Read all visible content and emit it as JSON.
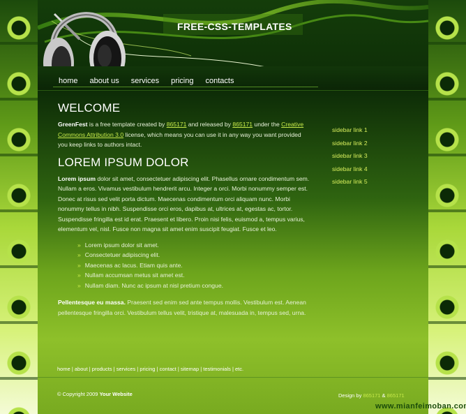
{
  "header": {
    "logo": "FREE-CSS-TEMPLATES"
  },
  "nav": {
    "items": [
      {
        "label": "home"
      },
      {
        "label": "about us"
      },
      {
        "label": "services"
      },
      {
        "label": "pricing"
      },
      {
        "label": "contacts"
      }
    ]
  },
  "welcome": {
    "title": "WELCOME",
    "brand": "GreenFest",
    "text1": " is a free template created by ",
    "link1": "865171",
    "text2": " and released by ",
    "link2": "865171",
    "text3": " under the ",
    "license": "Creative Commons Attribution 3.0",
    "text4": " license, which means you can use it in any way you want provided you keep links to authors intact."
  },
  "lorem": {
    "title": "LOREM IPSUM DOLOR",
    "p1_strong": "Lorem ipsum",
    "p1_text": " dolor sit amet, consectetuer adipiscing elit. Phasellus ornare condimentum sem. Nullam a eros. Vivamus vestibulum hendrerit arcu. Integer a orci. Morbi nonummy semper est. Donec at risus sed velit porta dictum. Maecenas condimentum orci aliquam nunc. Morbi nonummy tellus in nibh. Suspendisse orci eros, dapibus at, ultrices at, egestas ac, tortor. Suspendisse fringilla est id erat. Praesent et libero. Proin nisi felis, euismod a, tempus varius, elementum vel, nisl. Fusce non magna sit amet enim suscipit feugiat. Fusce et leo.",
    "list": [
      "Lorem ipsum dolor sit amet.",
      "Consectetuer adipiscing elit.",
      "Maecenas ac lacus. Etiam quis ante.",
      "Nullam accumsan metus sit amet est.",
      "Nullam diam. Nunc ac ipsum at nisl pretium congue."
    ],
    "bullet": "»",
    "p2_strong": "Pellentesque eu massa.",
    "p2_text": " Praesent sed enim sed ante tempus mollis. Vestibulum est. Aenean pellentesque fringilla orci. Vestibulum tellus velit, tristique at, malesuada in, tempus sed, urna."
  },
  "sidebar": {
    "links": [
      "sidebar link 1",
      "sidebar link 2",
      "sidebar link 3",
      "sidebar link 4",
      "sidebar link 5"
    ]
  },
  "footer": {
    "links": [
      "home",
      "about",
      "products",
      "services",
      "pricing",
      "contact",
      "sitemap",
      "testimonials",
      "etc."
    ],
    "separator": " | ",
    "copyright_prefix": "© Copyright 2009 ",
    "copyright_site": "Your Website",
    "design_prefix": "Design by ",
    "design_link1": "865171",
    "design_amp": " & ",
    "design_link2": "865171"
  },
  "watermark": "www.mianfeimoban.com",
  "colors": {
    "accent": "#c7ea4a",
    "background_dark": "#0d2c07",
    "background_light": "#8ec02a"
  },
  "icons": [
    "headphones-icon",
    "side-ornament-icon"
  ]
}
